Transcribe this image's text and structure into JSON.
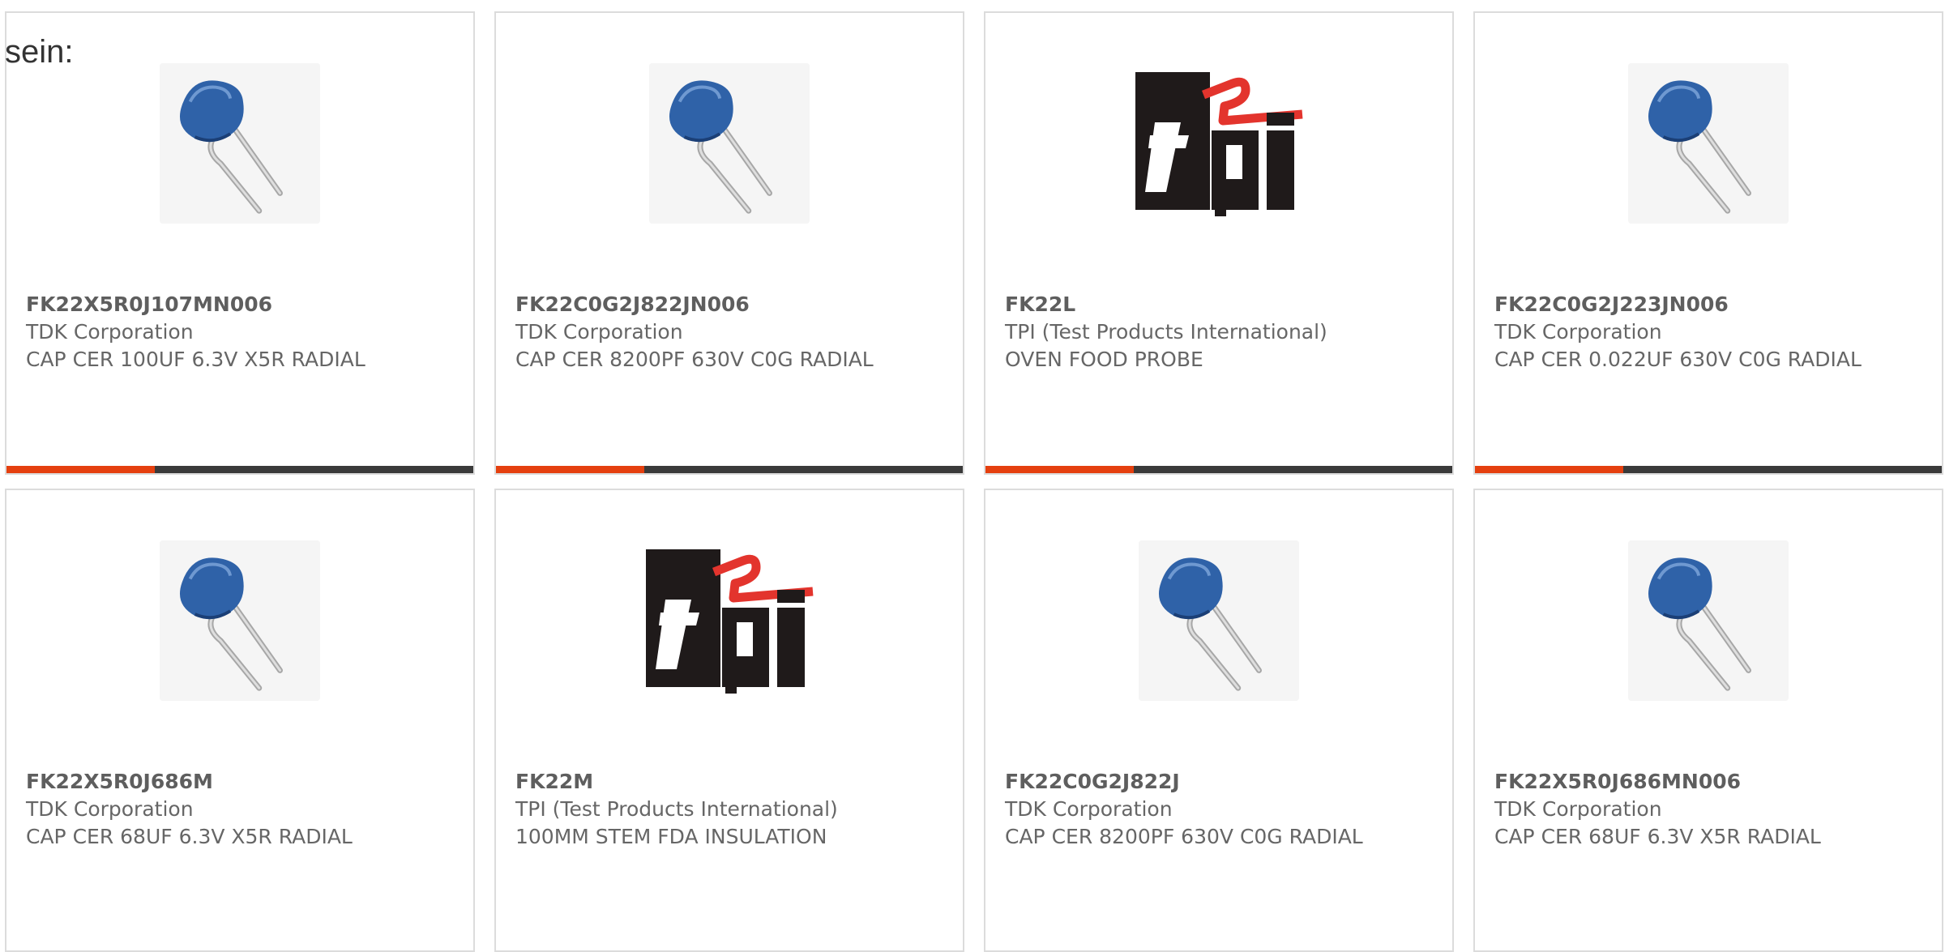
{
  "intro_label": "sein:",
  "colors": {
    "accent_bar": "#e5400f",
    "dark_bar": "#3a3a3a",
    "card_border": "#dcdcdc",
    "text": "#666666"
  },
  "products": [
    {
      "part_number": "FK22X5R0J107MN006",
      "manufacturer": "TDK Corporation",
      "description": "CAP CER 100UF 6.3V X5R RADIAL",
      "image": "radial-capacitor-image",
      "hover_bar": true
    },
    {
      "part_number": "FK22C0G2J822JN006",
      "manufacturer": "TDK Corporation",
      "description": "CAP CER 8200PF 630V C0G RADIAL",
      "image": "radial-capacitor-image",
      "hover_bar": true
    },
    {
      "part_number": "FK22L",
      "manufacturer": "TPI (Test Products International)",
      "description": "OVEN FOOD PROBE",
      "image": "tpi-logo-image",
      "hover_bar": true
    },
    {
      "part_number": "FK22C0G2J223JN006",
      "manufacturer": "TDK Corporation",
      "description": "CAP CER 0.022UF 630V C0G RADIAL",
      "image": "radial-capacitor-image",
      "hover_bar": true
    },
    {
      "part_number": "FK22X5R0J686M",
      "manufacturer": "TDK Corporation",
      "description": "CAP CER 68UF 6.3V X5R RADIAL",
      "image": "radial-capacitor-image",
      "hover_bar": false
    },
    {
      "part_number": "FK22M",
      "manufacturer": "TPI (Test Products International)",
      "description": "100MM STEM FDA INSULATION",
      "image": "tpi-logo-image",
      "hover_bar": false
    },
    {
      "part_number": "FK22C0G2J822J",
      "manufacturer": "TDK Corporation",
      "description": "CAP CER 8200PF 630V C0G RADIAL",
      "image": "radial-capacitor-image",
      "hover_bar": false
    },
    {
      "part_number": "FK22X5R0J686MN006",
      "manufacturer": "TDK Corporation",
      "description": "CAP CER 68UF 6.3V X5R RADIAL",
      "image": "radial-capacitor-image",
      "hover_bar": false
    }
  ]
}
